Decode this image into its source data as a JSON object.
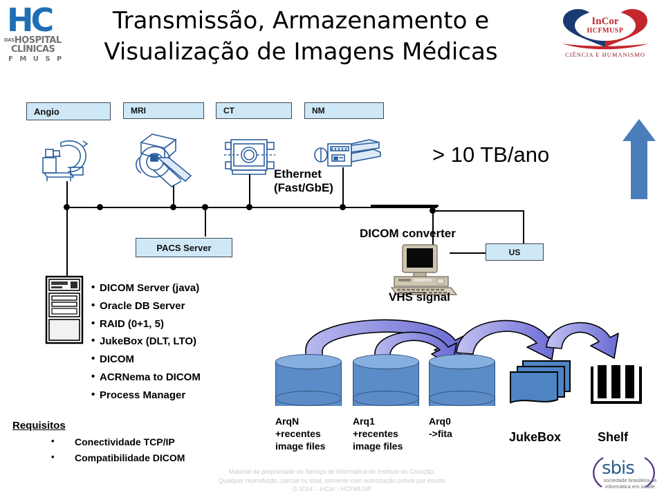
{
  "slide": {
    "title_line1": "Transmissão, Armazenamento e",
    "title_line2": "Visualização de Imagens Médicas",
    "capacity_note": "> 10 TB/ano"
  },
  "logos": {
    "hc": {
      "mark": "HC",
      "line1": "HOSPITAL",
      "das": "DAS",
      "line2": "CLÍNICAS",
      "line3": "F M U S P"
    },
    "incor": {
      "name": "InCor",
      "sub": "HCFMUSP",
      "tagline": "CIÊNCIA E HUMANISMO"
    },
    "sbis": {
      "word": "sbis",
      "tagline": "sociedade brasileira de informática em saúde"
    }
  },
  "modalities": [
    {
      "label": "Angio",
      "icon": "angio-c-arm-icon"
    },
    {
      "label": "MRI",
      "icon": "mri-scanner-icon"
    },
    {
      "label": "CT",
      "icon": "ct-scanner-icon"
    },
    {
      "label": "NM",
      "icon": "nm-gamma-camera-icon"
    }
  ],
  "network": {
    "ethernet_line1": "Ethernet",
    "ethernet_line2": "(Fast/GbE)"
  },
  "nodes": {
    "pacs_server": "PACS Server",
    "dicom_converter": "DICOM converter",
    "vhs_signal": "VHS signal",
    "us": "US"
  },
  "server_features": [
    "DICOM Server (java)",
    "Oracle DB Server",
    "RAID (0+1, 5)",
    "JukeBox (DLT, LTO)",
    "DICOM",
    "ACRNema to DICOM",
    "Process Manager"
  ],
  "requirements": {
    "title": "Requisitos",
    "items": [
      "Conectividade TCP/IP",
      "Compatibilidade DICOM"
    ]
  },
  "storage": {
    "cylinders": [
      {
        "name": "ArqN",
        "line2": "+recentes",
        "line3": "image files"
      },
      {
        "name": "Arq1",
        "line2": "+recentes",
        "line3": "image files"
      },
      {
        "name": "Arq0",
        "line2": "->fita",
        "line3": ""
      }
    ],
    "jukebox": "JukeBox",
    "shelf": "Shelf"
  },
  "footer": {
    "line1": "Material de propriedade do Serviço de Informática do Instituto do Coração.",
    "line2": "Qualquer reprodução, parcial ou total, somente com autorização prévia por escrito",
    "line3": "© 2014 – InCor - HCFMUSP"
  },
  "colors": {
    "box_fill": "#cfe8f7",
    "box_border": "#3c4650",
    "cylinder": "#5b8cc8",
    "arrow_purple": "#8f8fe0",
    "blue_arrow": "#4a7ebb",
    "hc_blue": "#1f6fb5",
    "incor_red": "#c1272d",
    "incor_navy": "#1b3a73"
  }
}
